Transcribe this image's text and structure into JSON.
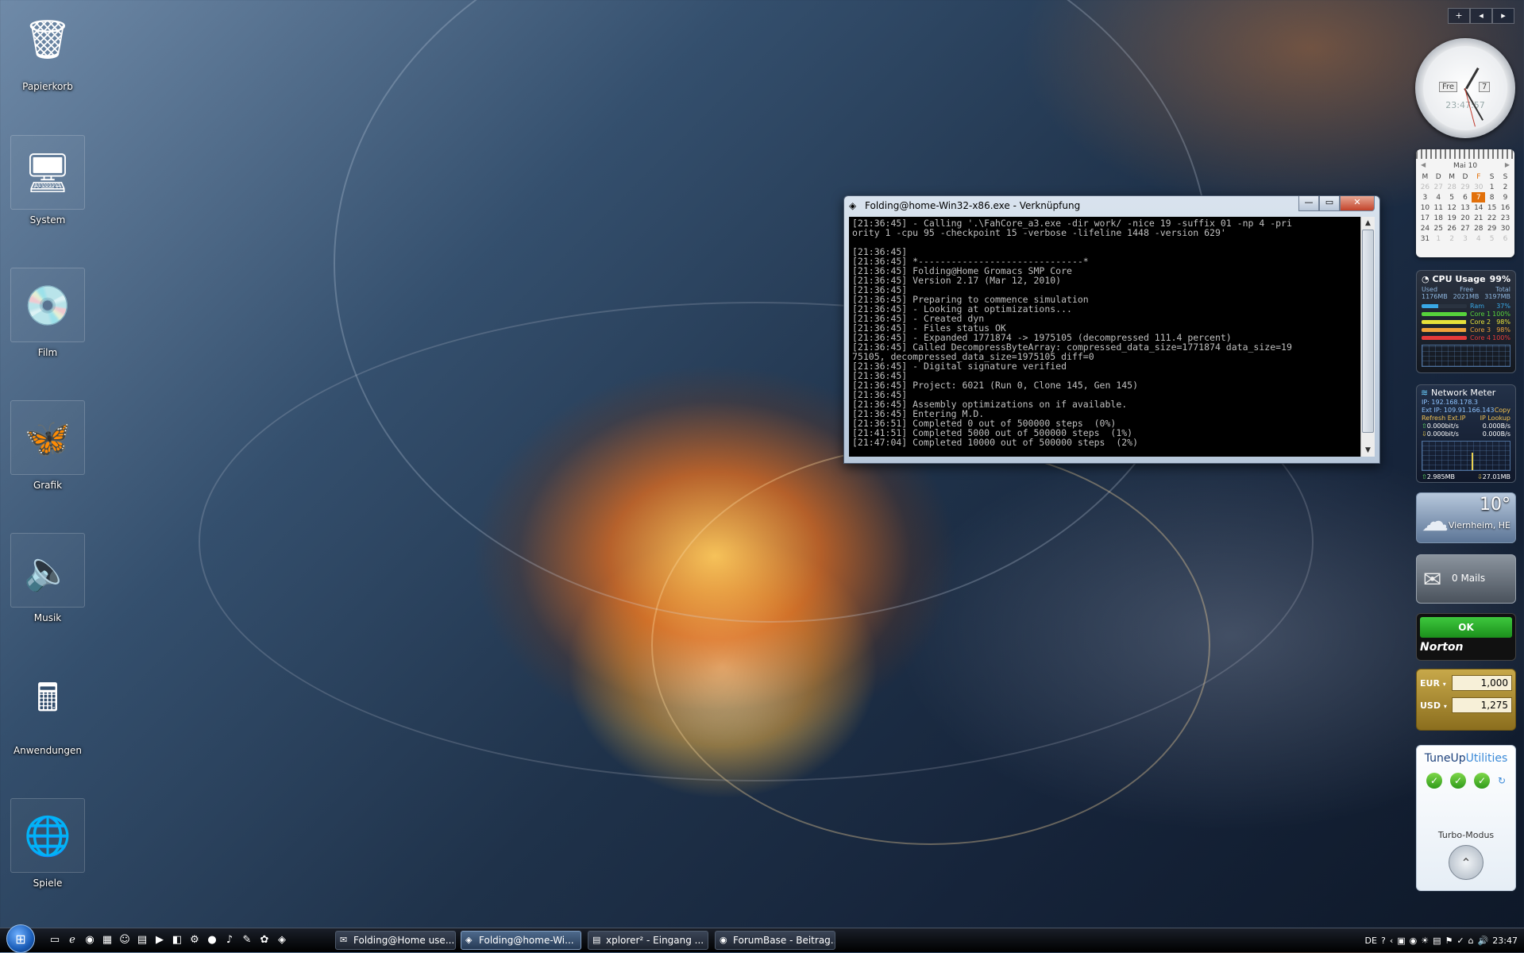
{
  "desktop_icons": [
    {
      "label": "Papierkorb",
      "icon": "recycle-bin-icon",
      "glyph": "🗑"
    },
    {
      "label": "System",
      "icon": "system-icon",
      "glyph": "🖥"
    },
    {
      "label": "Film",
      "icon": "dvd-icon",
      "glyph": "💿"
    },
    {
      "label": "Grafik",
      "icon": "butterfly-icon",
      "glyph": "🦋"
    },
    {
      "label": "Musik",
      "icon": "speaker-icon",
      "glyph": "🔈"
    },
    {
      "label": "Anwendungen",
      "icon": "apps-icon",
      "glyph": "🖩"
    },
    {
      "label": "Spiele",
      "icon": "games-icon",
      "glyph": "🌐"
    }
  ],
  "console": {
    "title": "Folding@home-Win32-x86.exe - Verknüpfung",
    "minimize": "—",
    "maximize": "▭",
    "close": "✕",
    "lines": [
      "[21:36:45] - Calling '.\\FahCore_a3.exe -dir work/ -nice 19 -suffix 01 -np 4 -pri",
      "ority 1 -cpu 95 -checkpoint 15 -verbose -lifeline 1448 -version 629'",
      "",
      "[21:36:45]",
      "[21:36:45] *------------------------------*",
      "[21:36:45] Folding@Home Gromacs SMP Core",
      "[21:36:45] Version 2.17 (Mar 12, 2010)",
      "[21:36:45]",
      "[21:36:45] Preparing to commence simulation",
      "[21:36:45] - Looking at optimizations...",
      "[21:36:45] - Created dyn",
      "[21:36:45] - Files status OK",
      "[21:36:45] - Expanded 1771874 -> 1975105 (decompressed 111.4 percent)",
      "[21:36:45] Called DecompressByteArray: compressed_data_size=1771874 data_size=19",
      "75105, decompressed_data_size=1975105 diff=0",
      "[21:36:45] - Digital signature verified",
      "[21:36:45]",
      "[21:36:45] Project: 6021 (Run 0, Clone 145, Gen 145)",
      "[21:36:45]",
      "[21:36:45] Assembly optimizations on if available.",
      "[21:36:45] Entering M.D.",
      "[21:36:51] Completed 0 out of 500000 steps  (0%)",
      "[21:41:51] Completed 5000 out of 500000 steps  (1%)",
      "[21:47:04] Completed 10000 out of 500000 steps  (2%)"
    ]
  },
  "sidebar": {
    "add": "+",
    "prev": "◂",
    "next": "▸"
  },
  "clock": {
    "day": "Fre",
    "date": "7",
    "digital": "23:47:57"
  },
  "calendar": {
    "month": "Mai 10",
    "weekdays": [
      "M",
      "D",
      "M",
      "D",
      "F",
      "S",
      "S"
    ],
    "weeks": [
      [
        "26",
        "27",
        "28",
        "29",
        "30",
        "1",
        "2"
      ],
      [
        "3",
        "4",
        "5",
        "6",
        "7",
        "8",
        "9"
      ],
      [
        "10",
        "11",
        "12",
        "13",
        "14",
        "15",
        "16"
      ],
      [
        "17",
        "18",
        "19",
        "20",
        "21",
        "22",
        "23"
      ],
      [
        "24",
        "25",
        "26",
        "27",
        "28",
        "29",
        "30"
      ],
      [
        "31",
        "1",
        "2",
        "3",
        "4",
        "5",
        "6"
      ]
    ],
    "today": "7"
  },
  "cpu": {
    "title": "CPU Usage",
    "total_percent": "99%",
    "headers": [
      "Used",
      "Free",
      "Total"
    ],
    "mem": [
      "1176MB",
      "2021MB",
      "3197MB"
    ],
    "rows": [
      {
        "label": "Ram",
        "value": "37%",
        "fill": 0.37,
        "color": "#39a8e6"
      },
      {
        "label": "Core 1",
        "value": "100%",
        "fill": 1.0,
        "color": "#56d33b"
      },
      {
        "label": "Core 2",
        "value": "98%",
        "fill": 0.98,
        "color": "#e6e13a"
      },
      {
        "label": "Core 3",
        "value": "98%",
        "fill": 0.98,
        "color": "#f0a23a"
      },
      {
        "label": "Core 4",
        "value": "100%",
        "fill": 1.0,
        "color": "#e63a3a"
      }
    ]
  },
  "network": {
    "title": "Network Meter",
    "ip": "IP: 192.168.178.3",
    "ext_ip": "Ext IP: 109.91.166.143",
    "copy": "Copy",
    "refresh": "Refresh Ext.IP",
    "lookup": "IP Lookup",
    "up_bits": "0.000bit/s",
    "up_bytes": "0.000B/s",
    "down_bits": "0.000bit/s",
    "down_bytes": "0.000B/s",
    "total_up": "2.985MB",
    "total_down": "27.01MB"
  },
  "weather": {
    "temp": "10°",
    "city": "Viernheim, HE"
  },
  "mail": {
    "text": "0 Mails"
  },
  "norton": {
    "status": "OK",
    "brand": "Norton"
  },
  "currency": [
    {
      "code": "EUR",
      "value": "1,000"
    },
    {
      "code": "USD",
      "value": "1,275"
    }
  ],
  "tuneup": {
    "brand1": "TuneUp",
    "brand2": "Utilities",
    "turbo": "Turbo-Modus"
  },
  "taskbar": {
    "tasks": [
      {
        "label": "Folding@Home use...",
        "icon": "✉",
        "active": false
      },
      {
        "label": "Folding@home-Wi...",
        "icon": "◈",
        "active": true
      },
      {
        "label": "xplorer² - Eingang ...",
        "icon": "▤",
        "active": false
      },
      {
        "label": "ForumBase - Beitrag...",
        "icon": "◉",
        "active": false
      }
    ],
    "language": "DE",
    "time": "23:47"
  }
}
